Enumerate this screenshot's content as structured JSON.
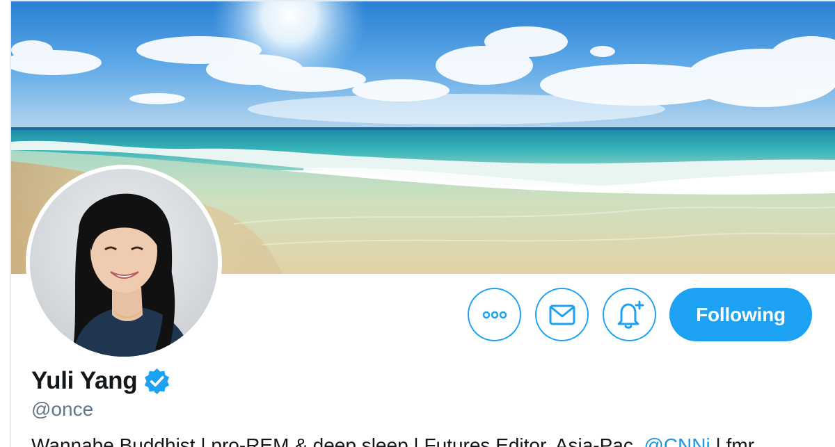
{
  "banner": {
    "description_icon": "beach-banner-image"
  },
  "avatar": {
    "icon": "profile-photo"
  },
  "actions": {
    "more_icon": "more-dots-icon",
    "message_icon": "envelope-icon",
    "notify_icon": "bell-plus-icon",
    "following_label": "Following"
  },
  "profile": {
    "display_name": "Yuli Yang",
    "verified_icon": "verified-badge-icon",
    "handle": "@once",
    "bio_prefix": "Wannabe Buddhist | pro-REM & deep sleep | Futures Editor, Asia-Pac, ",
    "bio_mention": "@CNNi",
    "bio_suffix": " | fmr"
  },
  "colors": {
    "accent": "#1da1f2",
    "name_text": "#14171a",
    "handle_text": "#657786",
    "mention": "#1b95e0"
  }
}
